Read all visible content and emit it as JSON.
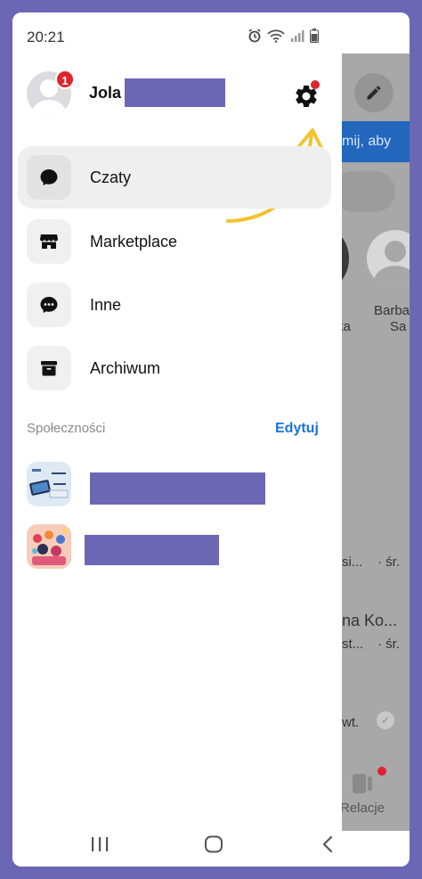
{
  "status_bar": {
    "time": "20:21"
  },
  "profile": {
    "name": "Jola",
    "notification_count": "1"
  },
  "menu": {
    "items": [
      {
        "label": "Czaty",
        "icon": "chat-bubble-icon"
      },
      {
        "label": "Marketplace",
        "icon": "store-icon"
      },
      {
        "label": "Inne",
        "icon": "chat-dots-icon"
      },
      {
        "label": "Archiwum",
        "icon": "archive-box-icon"
      }
    ]
  },
  "communities": {
    "title": "Społeczności",
    "edit_label": "Edytuj"
  },
  "background": {
    "banner_text": "mij, aby",
    "contact_partial_left": "ka",
    "contact_name_line1": "Barbar",
    "contact_name_line2": "Sa",
    "row1_left": "si...",
    "row1_right": "· śr.",
    "row2_name": "na Ko...",
    "row2_left": "st...",
    "row2_right": "· śr.",
    "row3_left": "wt.",
    "tab_label": "Relacje"
  },
  "colors": {
    "accent_blue": "#1a73d9",
    "badge_red": "#e0242e",
    "arrow_yellow": "#f2c230",
    "redaction": "#6b67b5"
  }
}
